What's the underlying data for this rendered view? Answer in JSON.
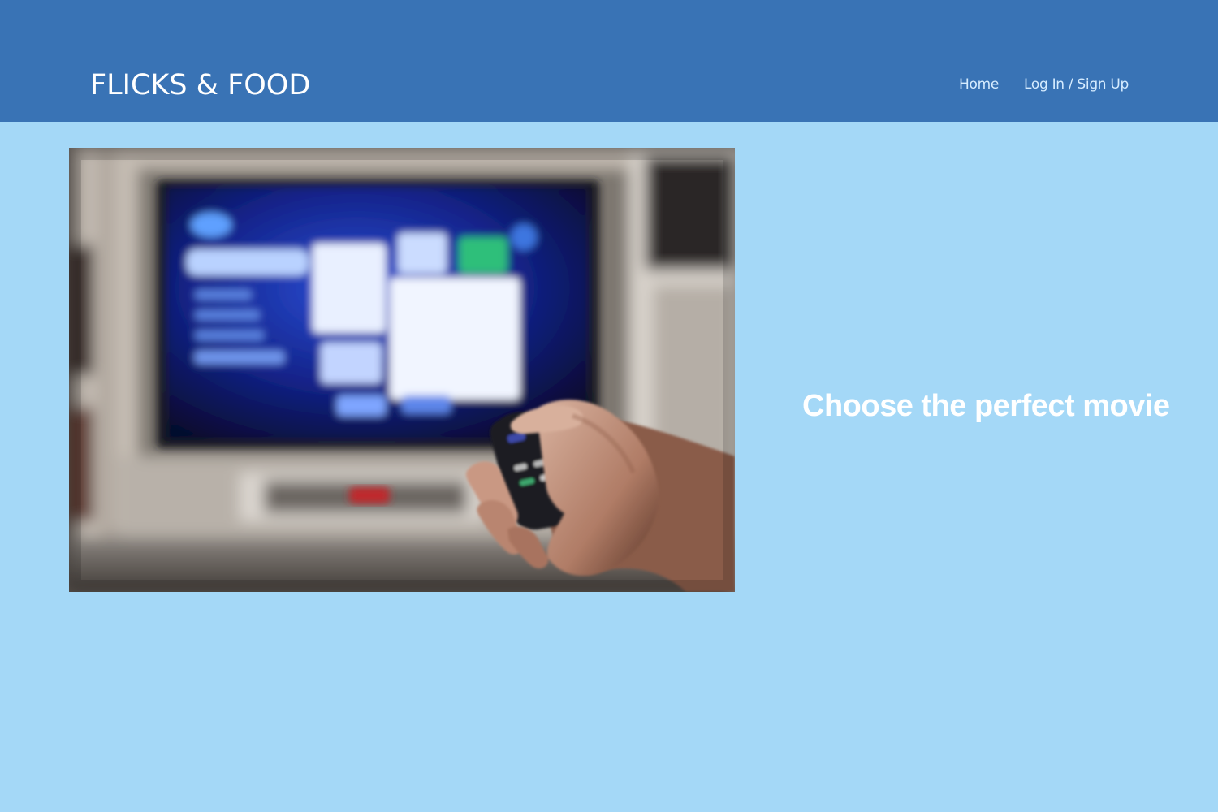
{
  "header": {
    "brand": "FLICKS & FOOD",
    "nav": [
      {
        "label": "Home"
      },
      {
        "label": "Log In / Sign Up"
      }
    ]
  },
  "hero": {
    "photo_alt": "hand-holding-remote-pointing-at-tv",
    "tagline": "Choose the perfect movie"
  },
  "colors": {
    "header_bg": "#3973b5",
    "page_bg": "#a4d8f7",
    "text_white": "#ffffff",
    "nav_text": "#d6ecff"
  }
}
